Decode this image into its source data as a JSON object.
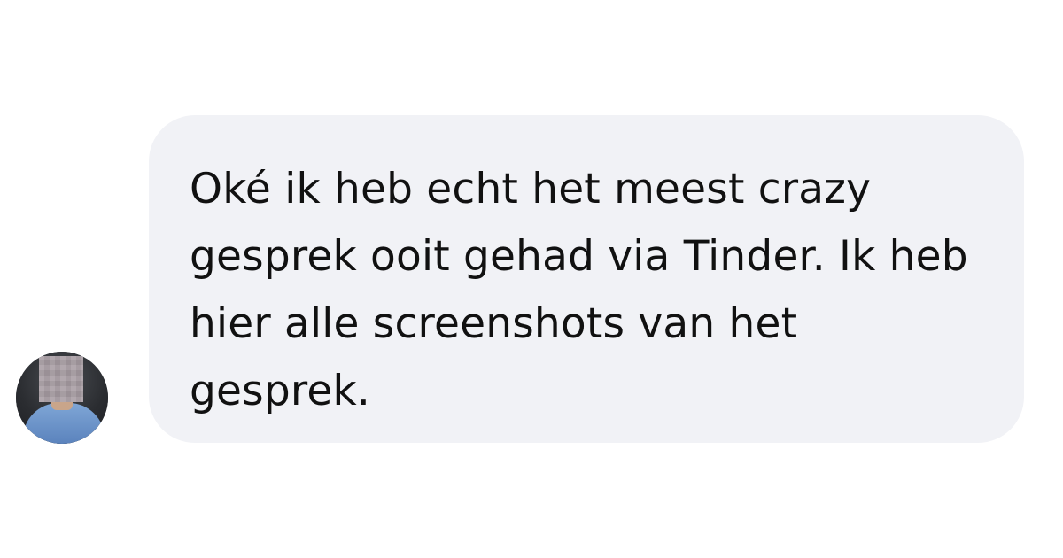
{
  "conversation": {
    "message": {
      "text": "Oké ik heb echt het meest crazy gesprek ooit gehad via Tinder. Ik heb hier alle screenshots van het gesprek."
    },
    "sender_avatar": {
      "icon": "person-avatar-icon",
      "obscured": true
    }
  },
  "colors": {
    "page_background": "#ffffff",
    "bubble_background": "#f1f2f6",
    "message_text": "#111111"
  }
}
